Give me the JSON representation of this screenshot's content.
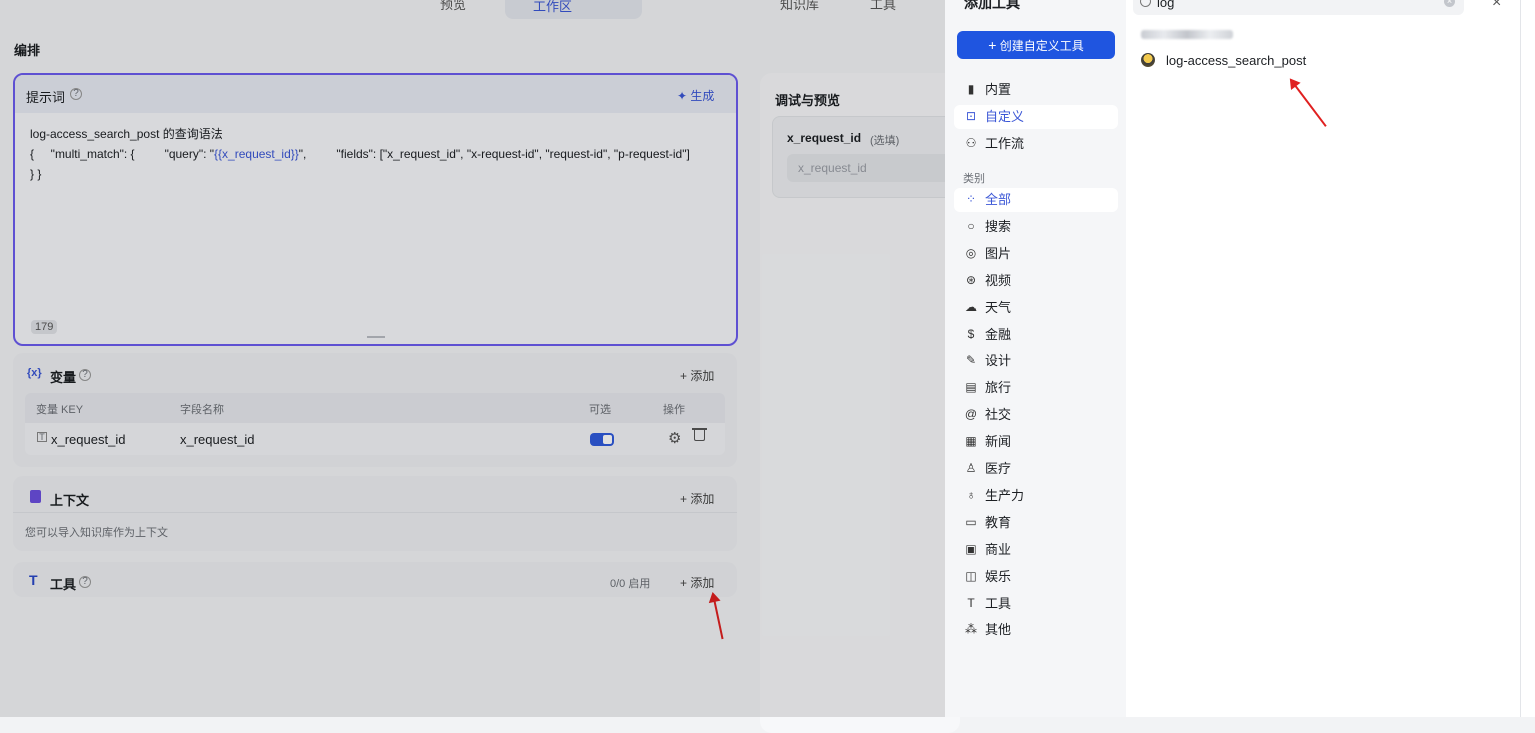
{
  "topnav": {
    "items": [
      "预览",
      "工作区",
      "知识库",
      "工具"
    ]
  },
  "orchestration": {
    "title": "编排",
    "prompt": {
      "title": "提示词",
      "generate_label": "生成",
      "line1": "log-access_search_post 的查询语法",
      "line2_a": "{     \"multi_match\": {         \"query\": \"",
      "line2_var": "{{x_request_id}}",
      "line2_b": "\",         \"fields\": [\"x_request_id\", \"x-request-id\", \"request-id\", \"p-request-id\"]",
      "line3": "}  }",
      "char_count": "179"
    },
    "variables": {
      "title": "变量",
      "add_label": "添加",
      "headers": [
        "变量 KEY",
        "字段名称",
        "可选",
        "操作"
      ],
      "rows": [
        {
          "key": "x_request_id",
          "name": "x_request_id",
          "optional": true
        }
      ]
    },
    "context": {
      "title": "上下文",
      "add_label": "添加",
      "hint": "您可以导入知识库作为上下文"
    },
    "tools": {
      "title": "工具",
      "status": "0/0 启用",
      "add_label": "添加"
    }
  },
  "debug": {
    "title": "调试与预览",
    "field_label": "x_request_id",
    "field_optional": "(选填)",
    "field_placeholder": "x_request_id"
  },
  "drawer": {
    "title": "添加工具",
    "create_button": "创建自定义工具",
    "search_value": "log",
    "nav": [
      {
        "label": "内置",
        "icon": "builtin-icon"
      },
      {
        "label": "自定义",
        "icon": "custom-icon",
        "active": true
      },
      {
        "label": "工作流",
        "icon": "workflow-icon"
      }
    ],
    "category_label": "类别",
    "categories": [
      {
        "label": "全部",
        "icon": "grid-icon",
        "active": true
      },
      {
        "label": "搜索",
        "icon": "search-icon"
      },
      {
        "label": "图片",
        "icon": "image-icon"
      },
      {
        "label": "视频",
        "icon": "video-icon"
      },
      {
        "label": "天气",
        "icon": "weather-icon"
      },
      {
        "label": "金融",
        "icon": "finance-icon"
      },
      {
        "label": "设计",
        "icon": "design-icon"
      },
      {
        "label": "旅行",
        "icon": "travel-icon"
      },
      {
        "label": "社交",
        "icon": "social-icon"
      },
      {
        "label": "新闻",
        "icon": "news-icon"
      },
      {
        "label": "医疗",
        "icon": "medical-icon"
      },
      {
        "label": "生产力",
        "icon": "productivity-icon"
      },
      {
        "label": "教育",
        "icon": "education-icon"
      },
      {
        "label": "商业",
        "icon": "business-icon"
      },
      {
        "label": "娱乐",
        "icon": "entertainment-icon"
      },
      {
        "label": "工具",
        "icon": "tool-icon"
      },
      {
        "label": "其他",
        "icon": "other-icon"
      }
    ],
    "results": [
      {
        "name": "log-access_search_post"
      }
    ]
  },
  "colors": {
    "accent": "#3a56d6",
    "arrow": "#e02020"
  }
}
